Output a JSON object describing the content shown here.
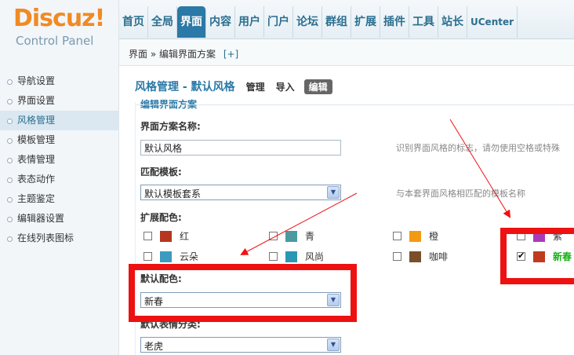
{
  "brand": {
    "logo": "Discuz!",
    "subtitle": "Control Panel"
  },
  "topnav": [
    {
      "label": "首页",
      "active": false
    },
    {
      "label": "全局",
      "active": false
    },
    {
      "label": "界面",
      "active": true
    },
    {
      "label": "内容",
      "active": false
    },
    {
      "label": "用户",
      "active": false
    },
    {
      "label": "门户",
      "active": false
    },
    {
      "label": "论坛",
      "active": false
    },
    {
      "label": "群组",
      "active": false
    },
    {
      "label": "扩展",
      "active": false
    },
    {
      "label": "插件",
      "active": false
    },
    {
      "label": "工具",
      "active": false
    },
    {
      "label": "站长",
      "active": false
    },
    {
      "label": "UCenter",
      "active": false
    }
  ],
  "breadcrumb": {
    "text": "界面 » 编辑界面方案",
    "add": "[+]"
  },
  "sidebar": [
    {
      "label": "导航设置"
    },
    {
      "label": "界面设置"
    },
    {
      "label": "风格管理",
      "active": true
    },
    {
      "label": "模板管理"
    },
    {
      "label": "表情管理"
    },
    {
      "label": "表态动作"
    },
    {
      "label": "主题鉴定"
    },
    {
      "label": "编辑器设置"
    },
    {
      "label": "在线列表图标"
    }
  ],
  "page": {
    "title": "风格管理 - 默认风格",
    "tabs": [
      {
        "label": "管理"
      },
      {
        "label": "导入"
      },
      {
        "label": "编辑",
        "active": true
      }
    ],
    "cut_heading": "编辑界面方案"
  },
  "form": {
    "name_label": "界面方案名称:",
    "name_value": "默认风格",
    "name_hint": "识别界面风格的标志，请勿使用空格或特殊",
    "template_label": "匹配模板:",
    "template_value": "默认模板套系",
    "template_hint": "与本套界面风格相匹配的模板名称",
    "ext_color_label": "扩展配色:",
    "colors": [
      {
        "label": "红",
        "color": "#b5371f",
        "checked": false
      },
      {
        "label": "青",
        "color": "#4a9aa0",
        "checked": false
      },
      {
        "label": "橙",
        "color": "#f39a14",
        "checked": false
      },
      {
        "label": "紫",
        "color": "#a83cb8",
        "checked": false
      },
      {
        "label": "云朵",
        "color": "#3d9ac1",
        "checked": false
      },
      {
        "label": "风尚",
        "color": "#2a97b5",
        "checked": false
      },
      {
        "label": "咖啡",
        "color": "#7b4e2a",
        "checked": false
      },
      {
        "label": "新春",
        "color": "#c03a1e",
        "checked": true
      }
    ],
    "default_color_label": "默认配色:",
    "default_color_value": "新春",
    "smiley_label": "默认表情分类:",
    "smiley_value": "老虎"
  },
  "annotation_color": "#ee1111"
}
